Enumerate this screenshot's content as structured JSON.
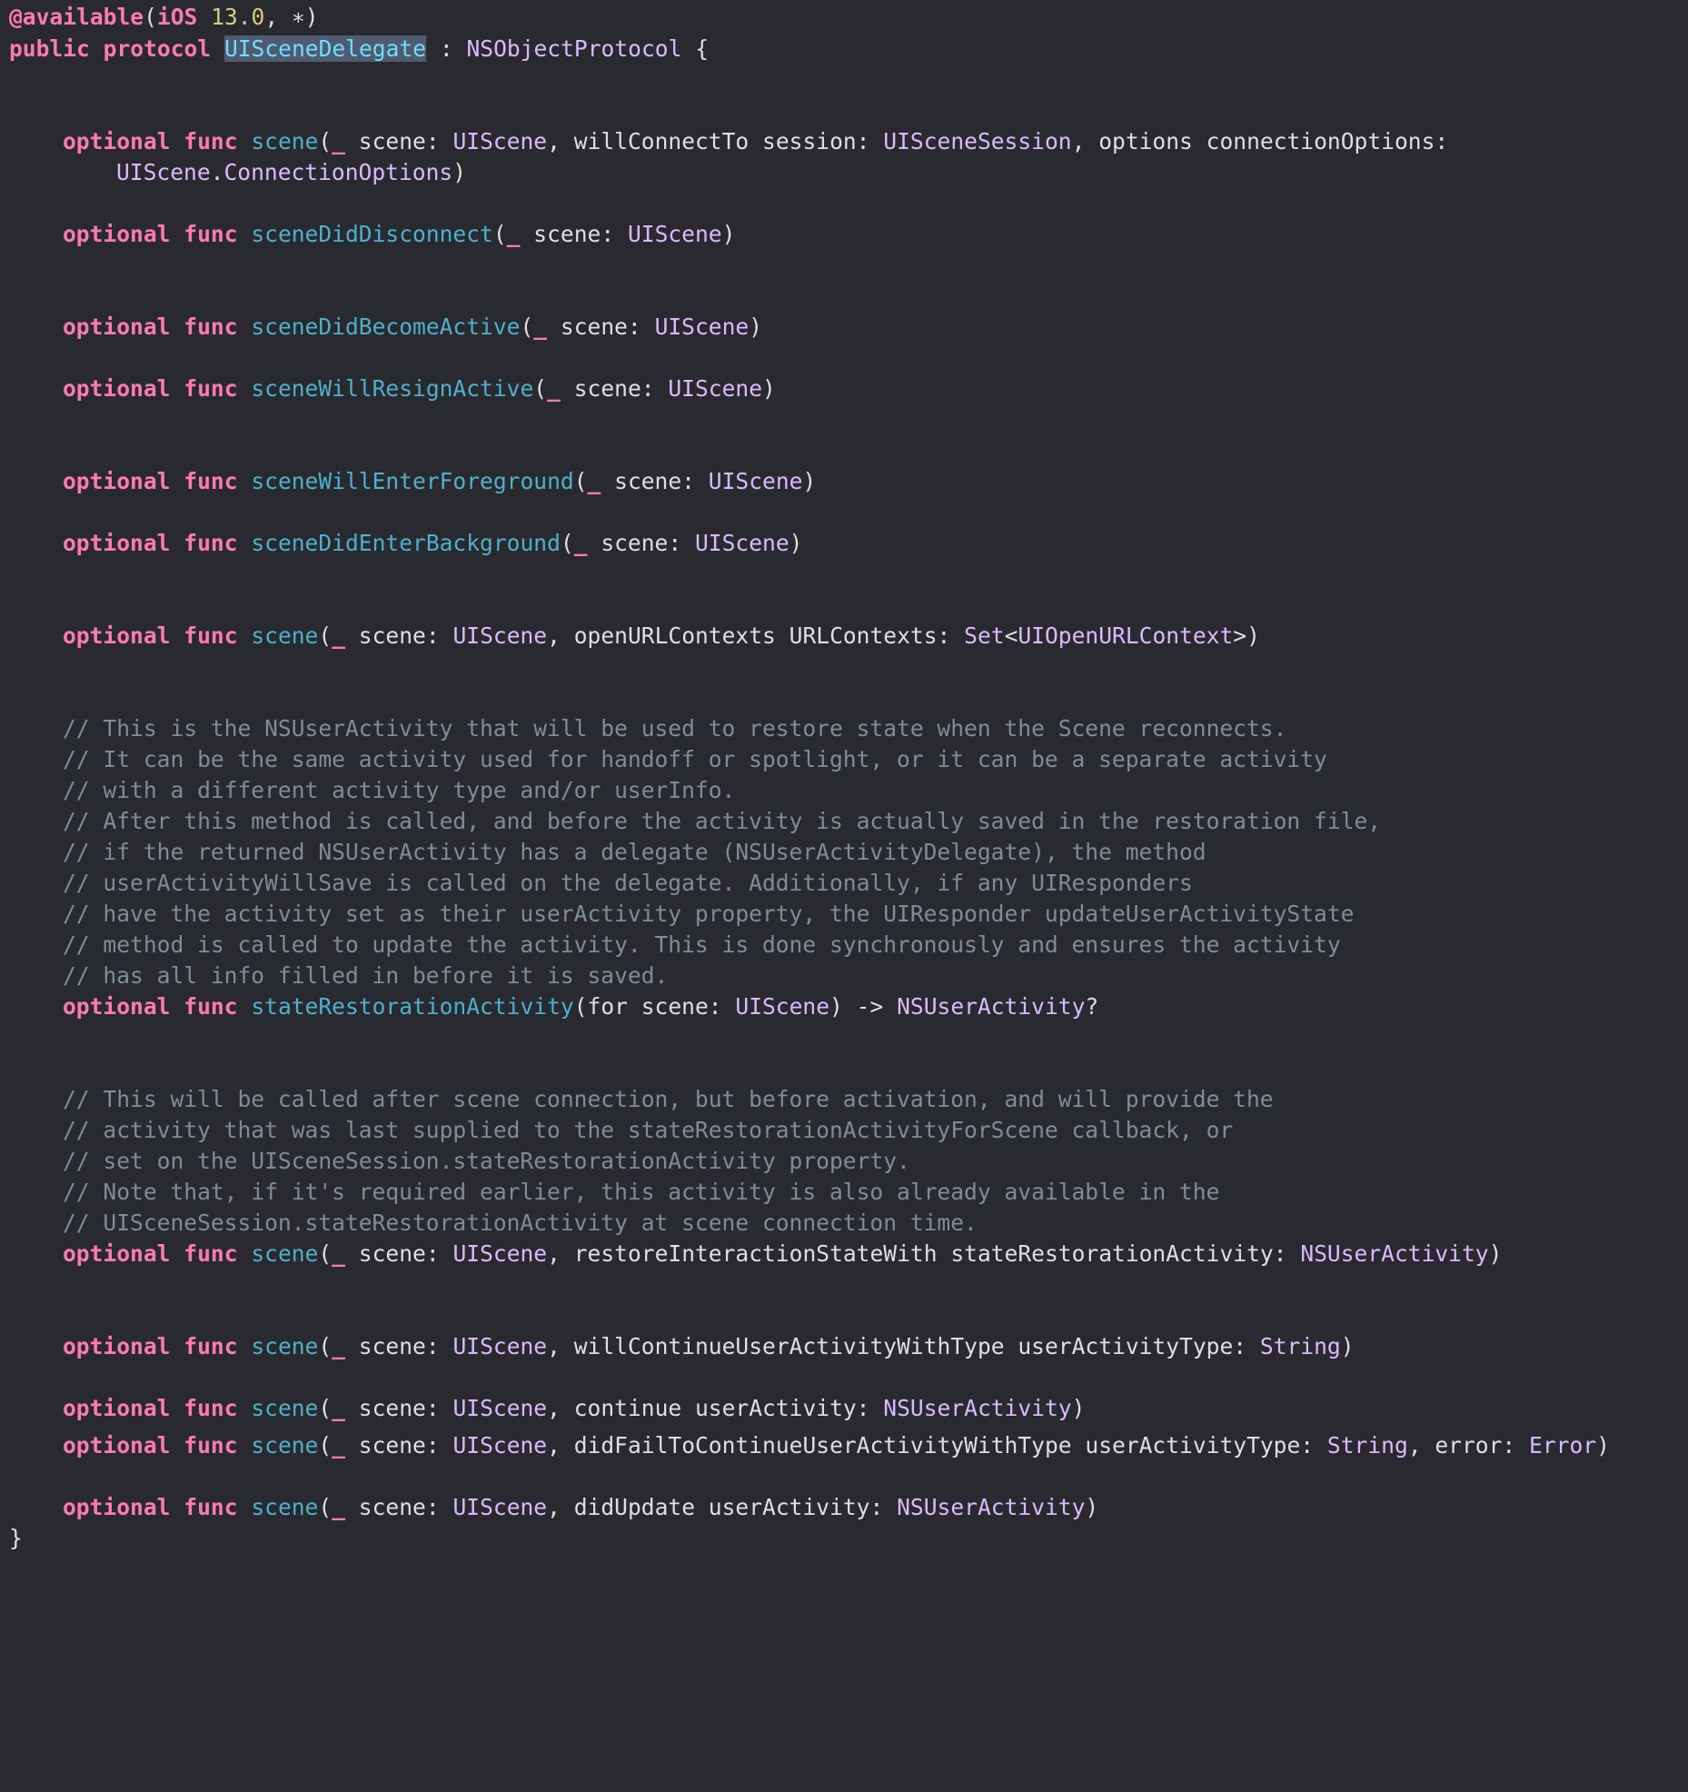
{
  "colors": {
    "background": "#292a30",
    "keyword": "#ff7ab2",
    "function_name": "#4eb0cc",
    "type_name": "#dabaff",
    "comment": "#7f8c98",
    "number": "#d9c97c",
    "plain": "#dfdfe0",
    "selection": "#515b70"
  },
  "t": {
    "available_attr": "@available",
    "ios": "iOS",
    "version": "13.0",
    "star": ", ∗)",
    "public": "public",
    "protocol": "protocol",
    "protocol_name": "UISceneDelegate",
    "base_proto": "NSObjectProtocol",
    "optional": "optional",
    "func": "func",
    "scene": "scene",
    "UIScene": "UIScene",
    "UISceneSession": "UISceneSession",
    "ConnectionOptions": "ConnectionOptions",
    "sceneDidDisconnect": "sceneDidDisconnect",
    "sceneDidBecomeActive": "sceneDidBecomeActive",
    "sceneWillResignActive": "sceneWillResignActive",
    "sceneWillEnterForeground": "sceneWillEnterForeground",
    "sceneDidEnterBackground": "sceneDidEnterBackground",
    "Set": "Set",
    "UIOpenURLContext": "UIOpenURLContext",
    "NSUserActivity": "NSUserActivity",
    "stateRestorationActivity": "stateRestorationActivity",
    "String": "String",
    "Error": "Error",
    "close_brace": "}",
    "p_open": "(",
    "p_close": ")",
    "underscore": "_",
    "p_scene_colon": " scene: ",
    "p_will_connect": ", willConnectTo session: ",
    "p_options": ", options connectionOptions:",
    "p_dot": ".",
    "p_open_urls": ", openURLContexts URLContexts: ",
    "p_lt": "<",
    "p_gt_close": ">)",
    "p_for_scene": "(for scene: ",
    "p_arrow": ") -> ",
    "p_question": "?",
    "p_restore": ", restoreInteractionStateWith stateRestorationActivity: ",
    "p_will_continue": ", willContinueUserActivityWithType userActivityType: ",
    "p_continue": ", continue userActivity: ",
    "p_did_fail": ", didFailToContinueUserActivityWithType userActivityType: ",
    "p_error": ", error: ",
    "p_did_update": ", didUpdate userActivity: ",
    "p_colon_brace": " : ",
    "p_open_brace": " {"
  },
  "comments_restoration": [
    "// This is the NSUserActivity that will be used to restore state when the Scene reconnects.",
    "// It can be the same activity used for handoff or spotlight, or it can be a separate activity",
    "// with a different activity type and/or userInfo.",
    "// After this method is called, and before the activity is actually saved in the restoration file,",
    "// if the returned NSUserActivity has a delegate (NSUserActivityDelegate), the method",
    "// userActivityWillSave is called on the delegate. Additionally, if any UIResponders",
    "// have the activity set as their userActivity property, the UIResponder updateUserActivityState",
    "// method is called to update the activity. This is done synchronously and ensures the activity",
    "// has all info filled in before it is saved."
  ],
  "comments_restore_interaction": [
    "// This will be called after scene connection, but before activation, and will provide the",
    "// activity that was last supplied to the stateRestorationActivityForScene callback, or",
    "// set on the UISceneSession.stateRestorationActivity property.",
    "// Note that, if it's required earlier, this activity is also already available in the",
    "// UISceneSession.stateRestorationActivity at scene connection time."
  ]
}
